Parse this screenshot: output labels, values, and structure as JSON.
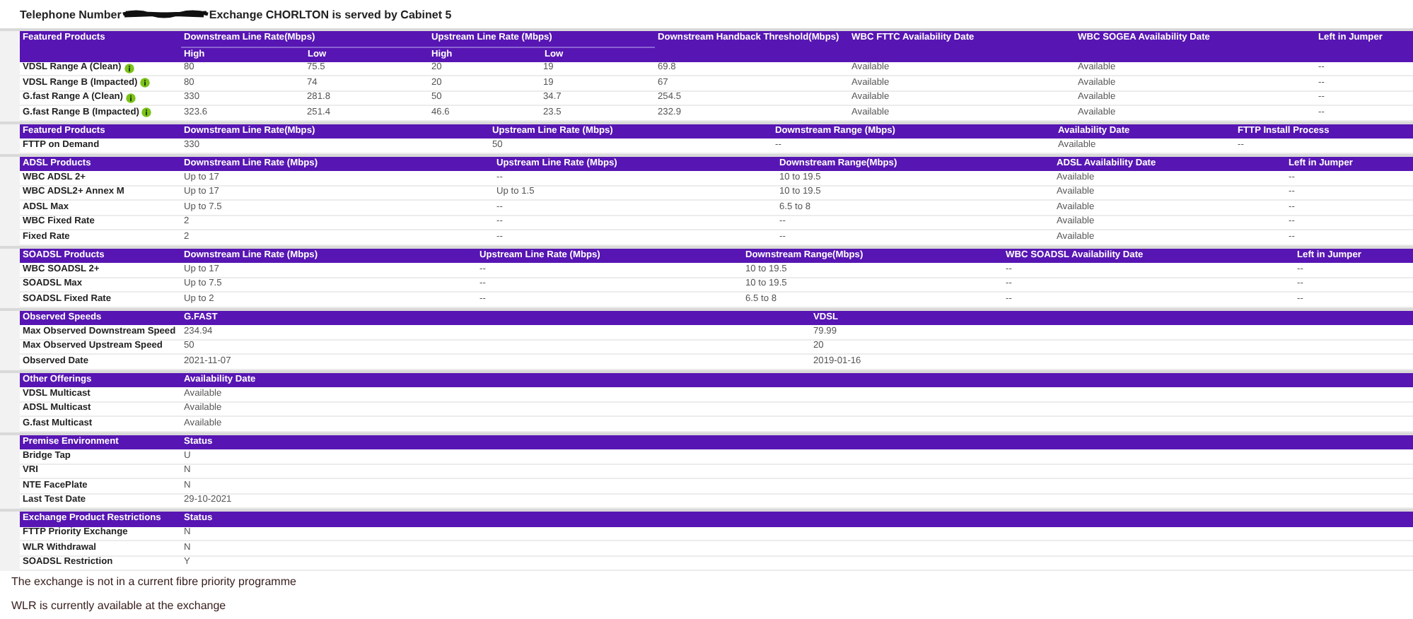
{
  "title": {
    "label": "Telephone Number",
    "rest": "Exchange CHORLTON is served by Cabinet 5"
  },
  "sections": [
    {
      "header": [
        {
          "label": "Featured Products"
        },
        {
          "label": "Downstream Line Rate(Mbps)",
          "subcolumns": [
            "High",
            "Low"
          ]
        },
        {
          "label": "Upstream Line Rate (Mbps)",
          "subcolumns": [
            "High",
            "Low"
          ]
        },
        {
          "label": "Downstream Handback Threshold(Mbps)"
        },
        {
          "label": "WBC FTTC Availability Date"
        },
        {
          "label": "WBC SOGEA Availability Date"
        },
        {
          "label": "Left in Jumper"
        }
      ],
      "rows": [
        {
          "name": "VDSL Range A (Clean)",
          "info": true,
          "cells": [
            "80",
            "75.5",
            "20",
            "19",
            "69.8",
            "Available",
            "Available",
            "--"
          ]
        },
        {
          "name": "VDSL Range B (Impacted)",
          "info": true,
          "cells": [
            "80",
            "74",
            "20",
            "19",
            "67",
            "Available",
            "Available",
            "--"
          ]
        },
        {
          "name": "G.fast Range A (Clean)",
          "info": true,
          "cells": [
            "330",
            "281.8",
            "50",
            "34.7",
            "254.5",
            "Available",
            "Available",
            "--"
          ]
        },
        {
          "name": "G.fast Range B (Impacted)",
          "info": true,
          "cells": [
            "323.6",
            "251.4",
            "46.6",
            "23.5",
            "232.9",
            "Available",
            "Available",
            "--"
          ]
        }
      ]
    },
    {
      "header": [
        {
          "label": "Featured Products"
        },
        {
          "label": "Downstream Line Rate(Mbps)"
        },
        {
          "label": "Upstream Line Rate (Mbps)"
        },
        {
          "label": "Downstream Range (Mbps)"
        },
        {
          "label": "Availability Date"
        },
        {
          "label": "FTTP Install Process"
        }
      ],
      "rows": [
        {
          "name": "FTTP on Demand",
          "info": false,
          "cells": [
            "330",
            "50",
            "--",
            "Available",
            "--"
          ]
        }
      ]
    },
    {
      "header": [
        {
          "label": "ADSL Products"
        },
        {
          "label": "Downstream Line Rate (Mbps)"
        },
        {
          "label": "Upstream Line Rate (Mbps)"
        },
        {
          "label": "Downstream Range(Mbps)"
        },
        {
          "label": "ADSL Availability Date"
        },
        {
          "label": "Left in Jumper"
        }
      ],
      "rows": [
        {
          "name": "WBC ADSL 2+",
          "info": false,
          "cells": [
            "Up to 17",
            "--",
            "10 to 19.5",
            "Available",
            "--"
          ]
        },
        {
          "name": "WBC ADSL2+ Annex M",
          "info": false,
          "cells": [
            "Up to 17",
            "Up to 1.5",
            "10 to 19.5",
            "Available",
            "--"
          ]
        },
        {
          "name": "ADSL Max",
          "info": false,
          "cells": [
            "Up to 7.5",
            "--",
            "6.5 to 8",
            "Available",
            "--"
          ]
        },
        {
          "name": "WBC Fixed Rate",
          "info": false,
          "cells": [
            "2",
            "--",
            "--",
            "Available",
            "--"
          ]
        },
        {
          "name": "Fixed Rate",
          "info": false,
          "cells": [
            "2",
            "--",
            "--",
            "Available",
            "--"
          ]
        }
      ]
    },
    {
      "header": [
        {
          "label": "SOADSL Products"
        },
        {
          "label": "Downstream Line Rate (Mbps)"
        },
        {
          "label": "Upstream Line Rate (Mbps)"
        },
        {
          "label": "Downstream Range(Mbps)"
        },
        {
          "label": "WBC SOADSL Availability Date"
        },
        {
          "label": "Left in Jumper"
        }
      ],
      "rows": [
        {
          "name": "WBC SOADSL 2+",
          "info": false,
          "cells": [
            "Up to 17",
            "--",
            "10 to 19.5",
            "--",
            "--"
          ]
        },
        {
          "name": "SOADSL Max",
          "info": false,
          "cells": [
            "Up to 7.5",
            "--",
            "10 to 19.5",
            "--",
            "--"
          ]
        },
        {
          "name": "SOADSL Fixed Rate",
          "info": false,
          "cells": [
            "Up to 2",
            "--",
            "6.5 to 8",
            "--",
            "--"
          ]
        }
      ]
    },
    {
      "header": [
        {
          "label": "Observed Speeds"
        },
        {
          "label": "G.FAST"
        },
        {
          "label": "VDSL"
        }
      ],
      "rows": [
        {
          "name": "Max Observed Downstream Speed",
          "cells": [
            "234.94",
            "79.99"
          ]
        },
        {
          "name": "Max Observed Upstream Speed",
          "cells": [
            "50",
            "20"
          ]
        },
        {
          "name": "Observed Date",
          "cells": [
            "2021-11-07",
            "2019-01-16"
          ]
        }
      ]
    },
    {
      "header": [
        {
          "label": "Other Offerings"
        },
        {
          "label": "Availability Date"
        }
      ],
      "rows": [
        {
          "name": "VDSL Multicast",
          "info": false,
          "cells": [
            "Available"
          ]
        },
        {
          "name": "ADSL Multicast",
          "info": false,
          "cells": [
            "Available"
          ]
        },
        {
          "name": "G.fast Multicast",
          "info": false,
          "cells": [
            "Available"
          ]
        }
      ]
    },
    {
      "header": [
        {
          "label": "Premise Environment"
        },
        {
          "label": "Status"
        }
      ],
      "rows": [
        {
          "name": "Bridge Tap",
          "info": false,
          "cells": [
            "U"
          ]
        },
        {
          "name": "VRI",
          "info": false,
          "cells": [
            "N"
          ]
        },
        {
          "name": "NTE FacePlate",
          "info": false,
          "cells": [
            "N"
          ]
        },
        {
          "name": "Last Test Date",
          "info": false,
          "cells": [
            "29-10-2021"
          ]
        }
      ]
    },
    {
      "header": [
        {
          "label": "Exchange Product Restrictions"
        },
        {
          "label": "Status"
        }
      ],
      "rows": [
        {
          "name": "FTTP Priority Exchange",
          "info": false,
          "cells": [
            "N"
          ]
        },
        {
          "name": "WLR Withdrawal",
          "info": false,
          "cells": [
            "N"
          ]
        },
        {
          "name": "SOADSL Restriction",
          "info": false,
          "cells": [
            "Y"
          ]
        }
      ]
    }
  ],
  "notes": [
    "The exchange is not in a current fibre priority programme",
    "WLR is currently available at the exchange"
  ]
}
